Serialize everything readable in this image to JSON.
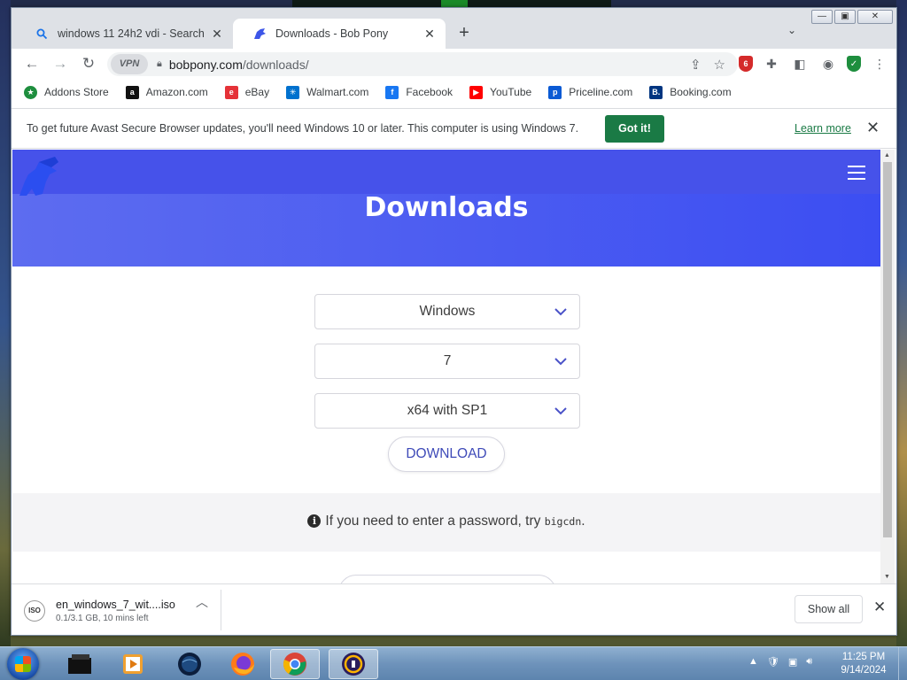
{
  "tabs": [
    {
      "title": "windows 11 24h2 vdi - Search",
      "icon": "search-icon"
    },
    {
      "title": "Downloads - Bob Pony",
      "icon": "bobpony-logo-icon"
    }
  ],
  "toolbar": {
    "vpn_label": "VPN",
    "url_host": "bobpony.com",
    "url_path": "/downloads/"
  },
  "bookmarks": [
    {
      "label": "Addons Store",
      "color": "#1e8e3e",
      "glyph": "★"
    },
    {
      "label": "Amazon.com",
      "color": "#111111",
      "glyph": "a"
    },
    {
      "label": "eBay",
      "color": "#e53238",
      "glyph": "e"
    },
    {
      "label": "Walmart.com",
      "color": "#0071ce",
      "glyph": "✳"
    },
    {
      "label": "Facebook",
      "color": "#1877f2",
      "glyph": "f"
    },
    {
      "label": "YouTube",
      "color": "#ff0000",
      "glyph": "▶"
    },
    {
      "label": "Priceline.com",
      "color": "#0a5ad4",
      "glyph": "p"
    },
    {
      "label": "Booking.com",
      "color": "#003580",
      "glyph": "B."
    }
  ],
  "infobar": {
    "message": "To get future Avast Secure Browser updates, you'll need Windows 10 or later. This computer is using Windows 7.",
    "got_it": "Got it!",
    "learn_more": "Learn more"
  },
  "page": {
    "title": "Downloads",
    "selects": [
      "Windows",
      "7",
      "x64 with SP1"
    ],
    "download_label": "DOWNLOAD",
    "hint_text": "If you need to enter a password, try",
    "hint_code": "bigcdn",
    "hint_end": "."
  },
  "download_shelf": {
    "filename": "en_windows_7_wit....iso",
    "status": "0.1/3.1 GB, 10 mins left",
    "show_all": "Show all"
  },
  "taskbar": {
    "time": "11:25 PM",
    "date": "9/14/2024"
  },
  "colors": {
    "accent": "#3e4ab8",
    "hero_start": "#5d6cf0",
    "hero_end": "#3c4ef2",
    "got_it_bg": "#1a7a45"
  }
}
